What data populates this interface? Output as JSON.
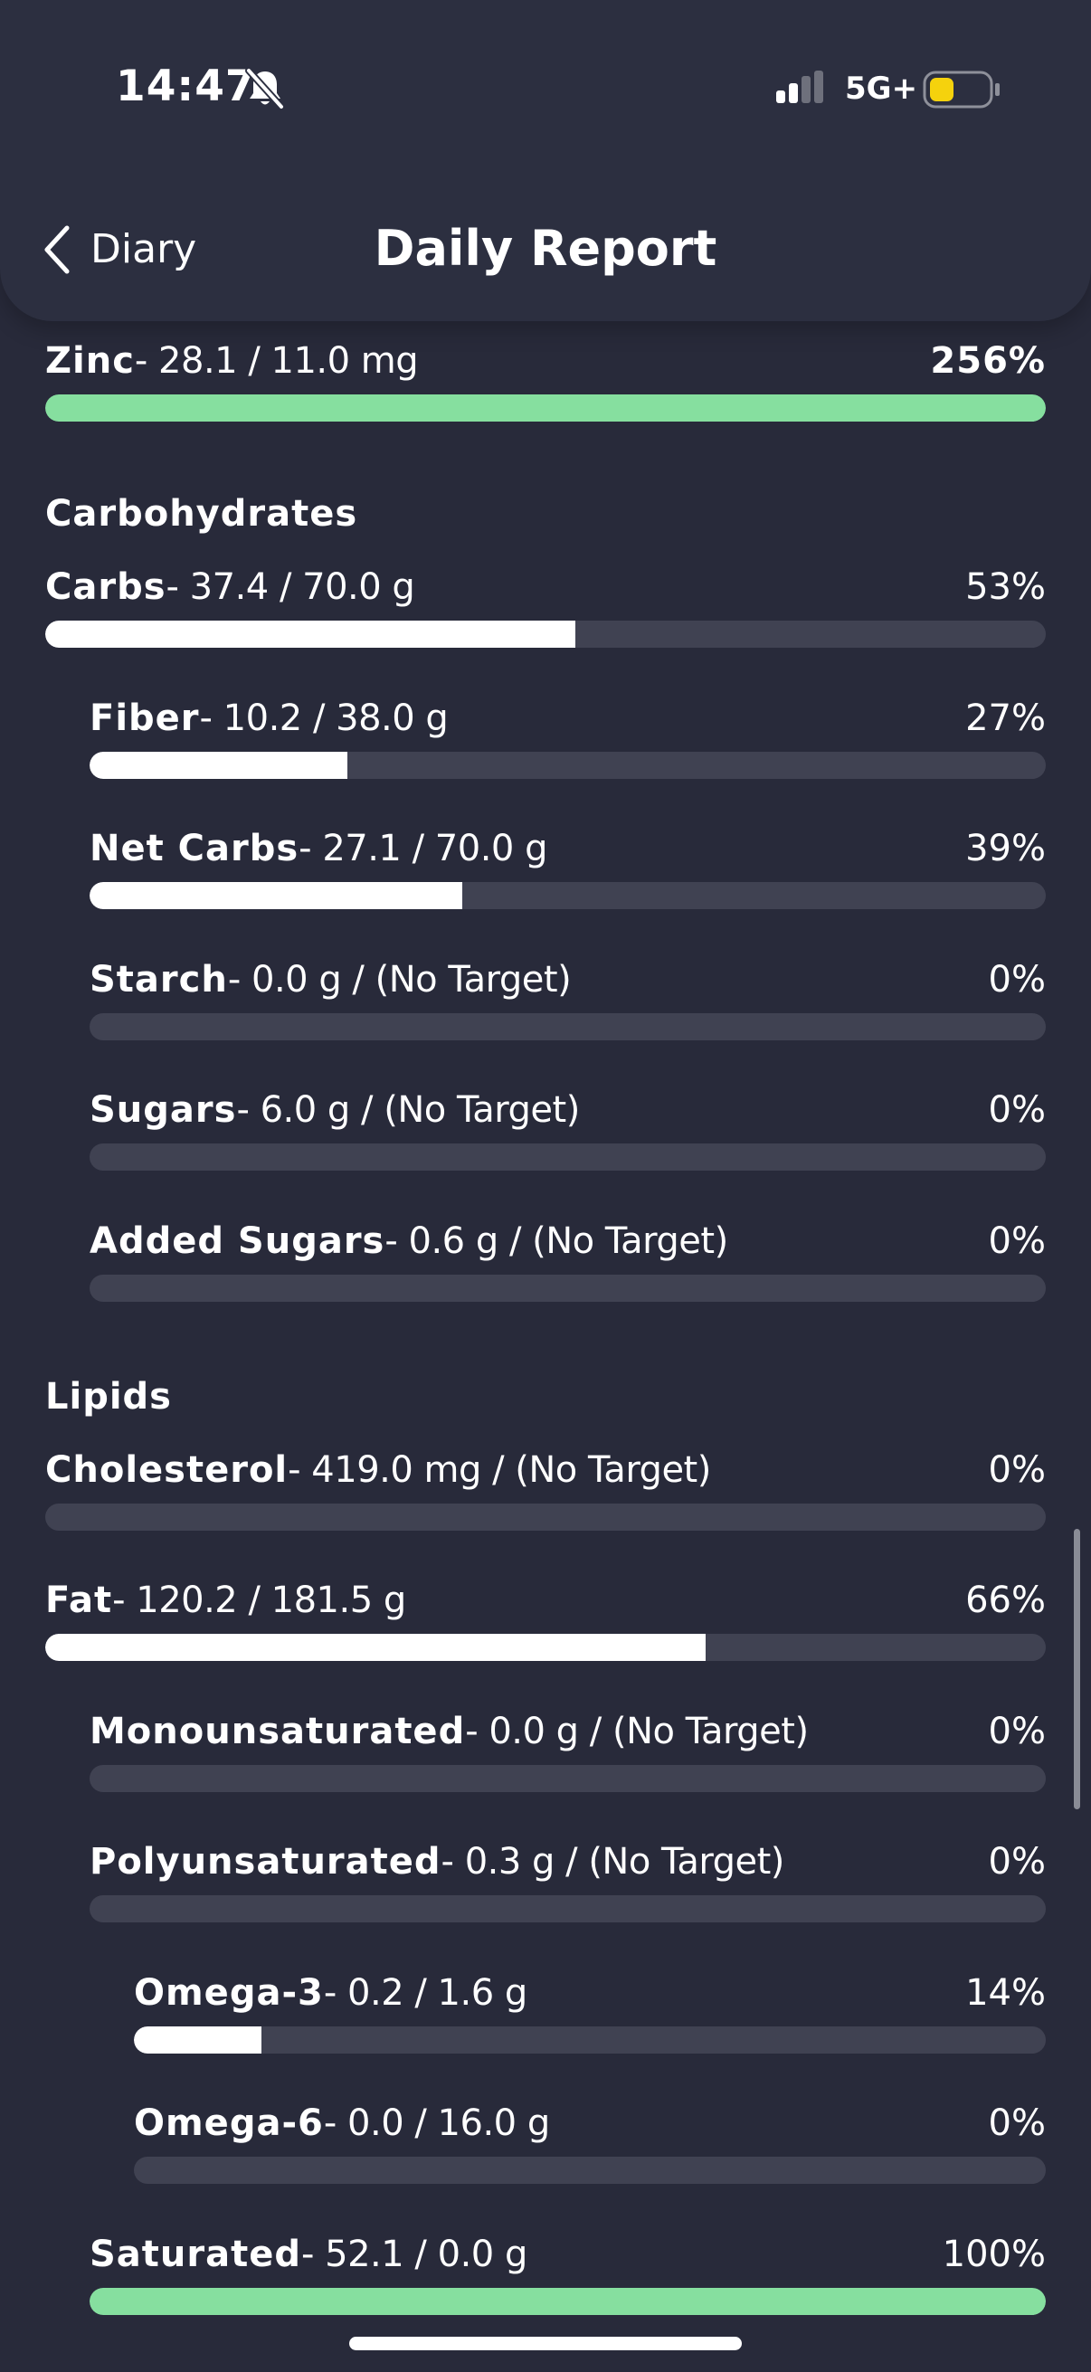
{
  "status_bar": {
    "time": "14:47",
    "network": "5G+",
    "battery_color": "#f5d20d"
  },
  "header": {
    "back_label": "Diary",
    "title": "Daily Report"
  },
  "colors": {
    "bar_fill": "#ffffff",
    "bar_over_target": "#86df9f",
    "bar_track": "#404252"
  },
  "sections": [
    {
      "title": "Carbohydrates"
    },
    {
      "title": "Lipids"
    }
  ],
  "nutrients": [
    {
      "name": "Zinc",
      "value": "- 28.1 / 11.0 mg",
      "percent": "256%",
      "fill": 1.0,
      "over": true
    },
    {
      "name": "Carbs",
      "value": "- 37.4 / 70.0 g",
      "percent": "53%",
      "fill": 0.53,
      "over": false
    },
    {
      "name": "Fiber",
      "value": "- 10.2 / 38.0 g",
      "percent": "27%",
      "fill": 0.27,
      "over": false
    },
    {
      "name": "Net Carbs",
      "value": "- 27.1 / 70.0 g",
      "percent": "39%",
      "fill": 0.39,
      "over": false
    },
    {
      "name": "Starch",
      "value": "- 0.0 g / (No Target)",
      "percent": "0%",
      "fill": 0,
      "over": false
    },
    {
      "name": "Sugars",
      "value": "- 6.0 g / (No Target)",
      "percent": "0%",
      "fill": 0,
      "over": false
    },
    {
      "name": "Added Sugars",
      "value": "- 0.6 g / (No Target)",
      "percent": "0%",
      "fill": 0,
      "over": false
    },
    {
      "name": "Cholesterol",
      "value": "- 419.0 mg / (No Target)",
      "percent": "0%",
      "fill": 0,
      "over": false
    },
    {
      "name": "Fat",
      "value": "- 120.2 / 181.5 g",
      "percent": "66%",
      "fill": 0.66,
      "over": false
    },
    {
      "name": "Monounsaturated",
      "value": "- 0.0 g / (No Target)",
      "percent": "0%",
      "fill": 0,
      "over": false
    },
    {
      "name": "Polyunsaturated",
      "value": "- 0.3 g / (No Target)",
      "percent": "0%",
      "fill": 0,
      "over": false
    },
    {
      "name": "Omega-3",
      "value": "- 0.2 / 1.6 g",
      "percent": "14%",
      "fill": 0.14,
      "over": false
    },
    {
      "name": "Omega-6",
      "value": "- 0.0 / 16.0 g",
      "percent": "0%",
      "fill": 0,
      "over": false
    },
    {
      "name": "Saturated",
      "value": "- 52.1 / 0.0 g",
      "percent": "100%",
      "fill": 1.0,
      "over": true
    }
  ]
}
